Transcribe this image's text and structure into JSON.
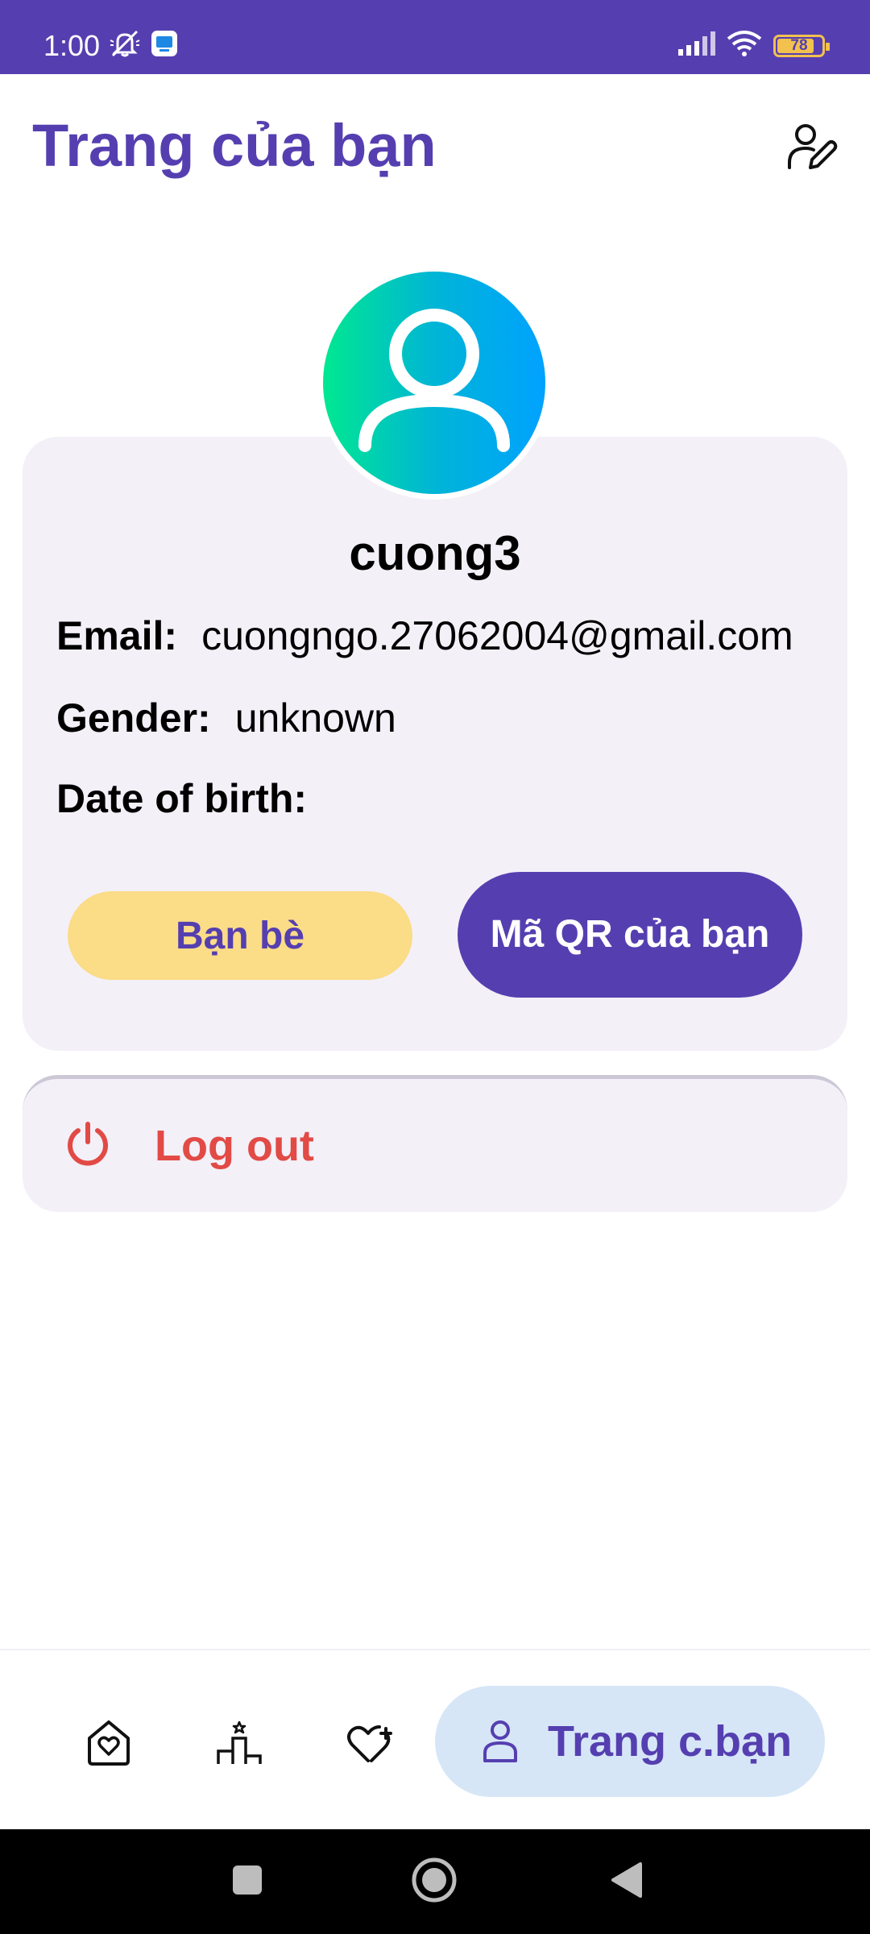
{
  "status_bar": {
    "time": "1:00",
    "battery_level": "78",
    "battery_fraction": 0.78,
    "icons": [
      "mute-icon",
      "app-notification-icon",
      "signal-icon",
      "wifi-icon",
      "battery-icon"
    ]
  },
  "header": {
    "title": "Trang của bạn",
    "edit_icon": "edit-profile-icon"
  },
  "profile": {
    "avatar_icon": "user-avatar-icon",
    "username": "cuong3",
    "email_label": "Email:",
    "email_value": "cuongngo.27062004@gmail.com",
    "gender_label": "Gender:",
    "gender_value": "unknown",
    "dob_label": "Date of birth:",
    "dob_value": "",
    "friends_button": "Bạn bè",
    "qr_button": "Mã QR của bạn"
  },
  "logout": {
    "label": "Log out",
    "icon": "power-icon"
  },
  "bottom_nav": {
    "items": [
      {
        "icon": "home-heart-icon"
      },
      {
        "icon": "ranking-icon"
      },
      {
        "icon": "heart-plus-icon"
      },
      {
        "icon": "person-icon",
        "label": "Trang c.bạn",
        "active": true
      }
    ]
  },
  "colors": {
    "primary": "#553fb0",
    "friends_button": "#fbdc87",
    "card_bg": "#f3f0f8",
    "logout": "#e24a46",
    "active_tab_bg": "#d6e6f7"
  }
}
